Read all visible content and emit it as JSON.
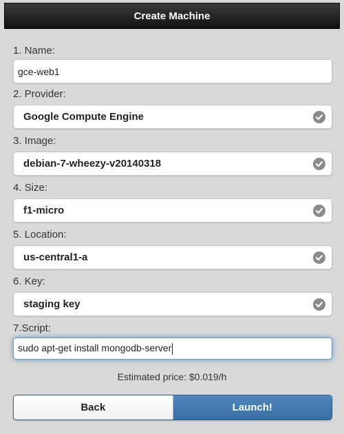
{
  "header": {
    "title": "Create Machine"
  },
  "form": {
    "name": {
      "label": "1. Name:",
      "value": "gce-web1"
    },
    "provider": {
      "label": "2. Provider:",
      "value": "Google Compute Engine"
    },
    "image": {
      "label": "3. Image:",
      "value": "debian-7-wheezy-v20140318"
    },
    "size": {
      "label": "4. Size:",
      "value": "f1-micro"
    },
    "location": {
      "label": "5. Location:",
      "value": "us-central1-a"
    },
    "key": {
      "label": "6. Key:",
      "value": "staging key"
    },
    "script": {
      "label": "7.Script:",
      "value": "sudo apt-get install mongodb-server"
    }
  },
  "estimate": {
    "text": "Estimated price: $0.019/h"
  },
  "actions": {
    "back_label": "Back",
    "launch_label": "Launch!"
  },
  "icons": {
    "selected": "check-circle-icon"
  },
  "colors": {
    "header": "#1e1e1e",
    "launch": "#3e74a8",
    "check": "#8b8b8b"
  }
}
